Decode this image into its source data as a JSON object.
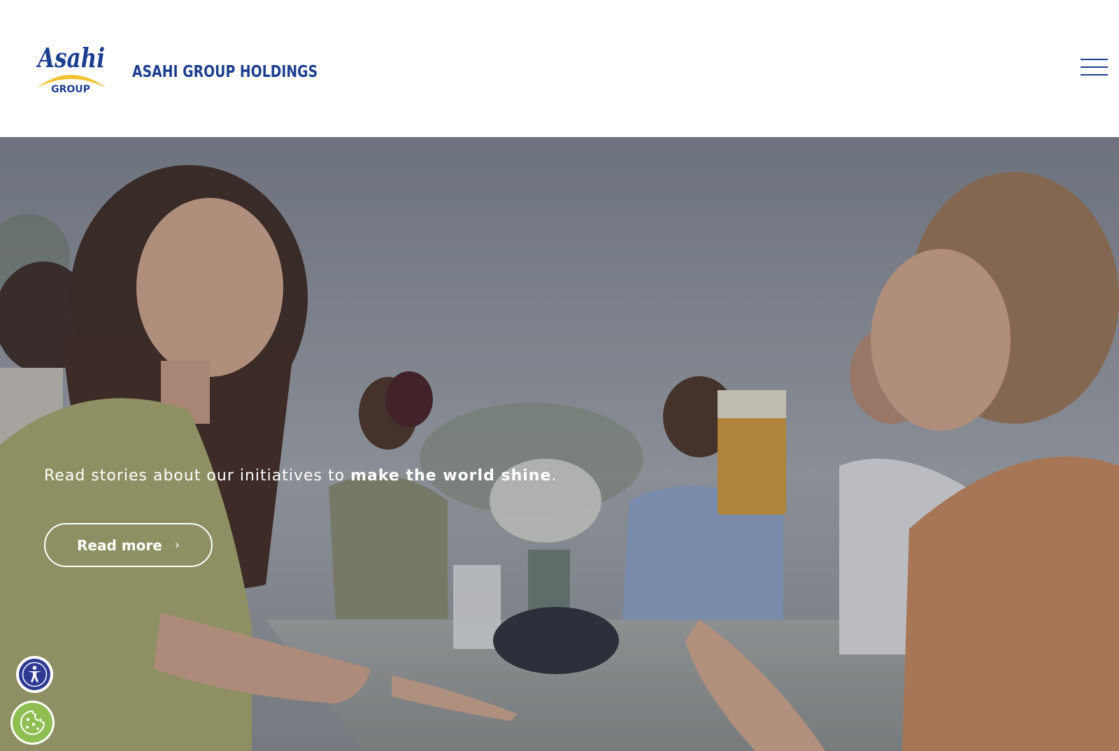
{
  "header": {
    "logo": {
      "wordmark": "Asahi",
      "subtext": "GROUP",
      "colors": {
        "blue": "#1d3f8f",
        "gold": "#f2c230"
      }
    },
    "company_name": "ASAHI GROUP HOLDINGS",
    "menu_icon": "hamburger-menu-icon"
  },
  "hero": {
    "tagline_normal": "Read stories about our initiatives to ",
    "tagline_bold": "make the world shine",
    "tagline_end": ".",
    "cta_label": "Read more",
    "cta_icon": "chevron-right-icon",
    "cta_icon_glyph": "›"
  },
  "floating": {
    "accessibility_icon": "accessibility-icon",
    "cookie_icon": "cookie-icon"
  }
}
